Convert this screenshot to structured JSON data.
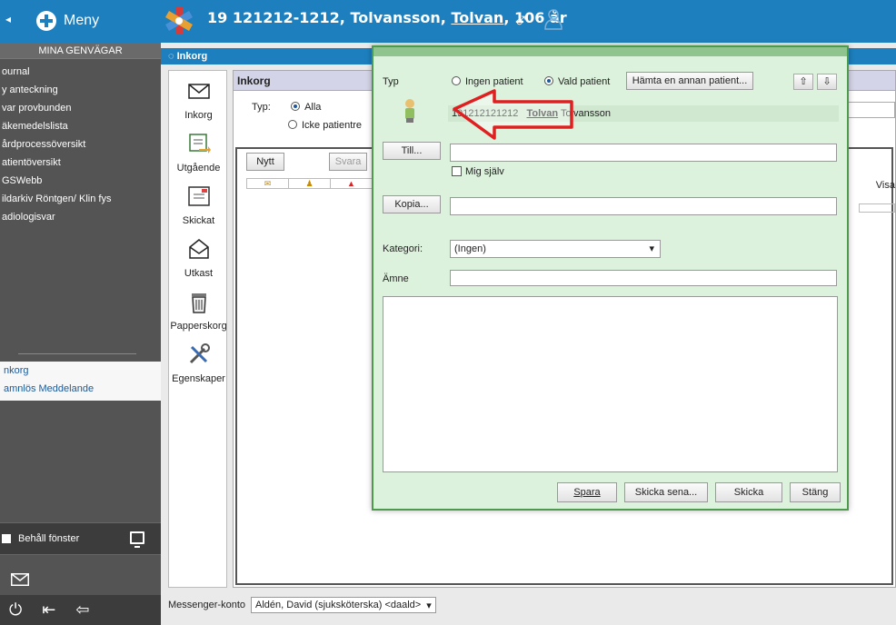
{
  "topbar": {
    "menu_label": "Meny",
    "patient_id": "19 121212-1212,",
    "patient_last": "Tolvansson,",
    "patient_first": "Tolvan",
    "patient_age": ", 106 år",
    "gender_symbol": "♂",
    "icons": [
      "back-icon",
      "plus-icon",
      "star-of-life-icon",
      "male-icon",
      "person-icon"
    ]
  },
  "sidebar": {
    "title": "MINA GENVÄGAR",
    "items": [
      {
        "label": "ournal"
      },
      {
        "label": "y anteckning"
      },
      {
        "label": "var provbunden"
      },
      {
        "label": "äkemedelslista"
      },
      {
        "label": "årdprocessöversikt"
      },
      {
        "label": "atientöversikt"
      },
      {
        "label": "GSWebb"
      },
      {
        "label": "ildarkiv Röntgen/ Klin fys"
      },
      {
        "label": "adiologisvar"
      }
    ],
    "open_windows": [
      {
        "label": "nkorg"
      },
      {
        "label": "amnlös Meddelande"
      }
    ],
    "keep_window_label": "Behåll fönster"
  },
  "main": {
    "tab_label": "Inkorg",
    "nav": [
      {
        "label": "Inkorg",
        "icon": "envelope-icon"
      },
      {
        "label": "Utgående",
        "icon": "outbox-icon"
      },
      {
        "label": "Skickat",
        "icon": "sent-icon"
      },
      {
        "label": "Utkast",
        "icon": "draft-icon"
      },
      {
        "label": "Papperskorg",
        "icon": "trash-icon"
      },
      {
        "label": "Egenskaper",
        "icon": "tools-icon"
      }
    ],
    "inbox": {
      "header": "Inkorg",
      "type_label": "Typ:",
      "filter_all": "Alla",
      "filter_non_patient": "Icke patientre",
      "new_button": "Nytt",
      "reply_button": "Svara",
      "visa_label": "Visa"
    },
    "messenger_label": "Messenger-konto",
    "messenger_value": "Aldén, David (sjuksköterska) <daald>"
  },
  "dialog": {
    "typ_label": "Typ",
    "no_patient": "Ingen patient",
    "selected_patient": "Vald patient",
    "fetch_patient_button": "Hämta en annan patient...",
    "patient_number": "191212121212",
    "patient_first": "Tolvan",
    "patient_last": "Tolvansson",
    "to_button": "Till...",
    "to_value": "",
    "self_label": "Mig själv",
    "cc_button": "Kopia...",
    "cc_value": "",
    "category_label": "Kategori:",
    "category_value": "(Ingen)",
    "subject_label": "Ämne",
    "subject_value": "",
    "body_value": "",
    "save_button": "Spara",
    "send_later_button": "Skicka sena...",
    "send_button": "Skicka",
    "close_button": "Stäng"
  },
  "colors": {
    "topbar": "#1d7fbd",
    "sidebar": "#545454",
    "dialog_bg": "#ddf2dd",
    "dialog_border": "#4d9a4d",
    "annotation_arrow": "#e02020"
  }
}
